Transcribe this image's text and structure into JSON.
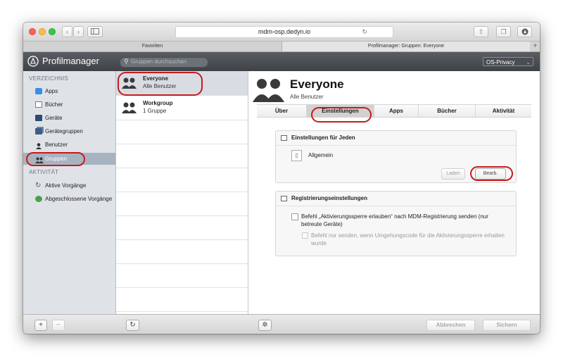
{
  "browser": {
    "url": "mdm-osp.dedyn.io",
    "tabs": [
      "Favoriten",
      "Profilmanager: Gruppen: Everyone"
    ]
  },
  "app": {
    "title": "Profilmanager",
    "search_placeholder": "Gruppen durchsuchen",
    "org_select": "OS-Privacy"
  },
  "sidebar": {
    "section1": "VERZEICHNIS",
    "items": [
      "Apps",
      "Bücher",
      "Geräte",
      "Gerätegruppen",
      "Benutzer",
      "Gruppen"
    ],
    "section2": "AKTIVITÄT",
    "activity": [
      "Aktive Vorgänge",
      "Abgeschlossene Vorgänge"
    ]
  },
  "groups": [
    {
      "name": "Everyone",
      "sub": "Alle Benutzer"
    },
    {
      "name": "Workgroup",
      "sub": "1 Gruppe"
    }
  ],
  "detail": {
    "title": "Everyone",
    "subtitle": "Alle Benutzer",
    "tabs": [
      "Über",
      "Einstellungen",
      "Apps",
      "Bücher",
      "Aktivität"
    ],
    "panel1": {
      "title": "Einstellungen für Jeden",
      "item": "Allgemein",
      "load_button": "Laden",
      "edit_button": "Bearb."
    },
    "panel2": {
      "title": "Registrierungseinstellungen",
      "option1": "Befehl „Aktivierungssperre erlauben“ nach MDM-Registrierung senden (nur betreute Geräte)",
      "option2": "Befehl nur senden, wenn Umgehungscode für die Aktivierungssperre erhalten wurde"
    }
  },
  "footer": {
    "cancel": "Abbrechen",
    "save": "Sichern"
  },
  "colors": {
    "highlight": "#c61b1b",
    "selection": "#b6c0cc",
    "sidebar": "#dfe3e8"
  }
}
